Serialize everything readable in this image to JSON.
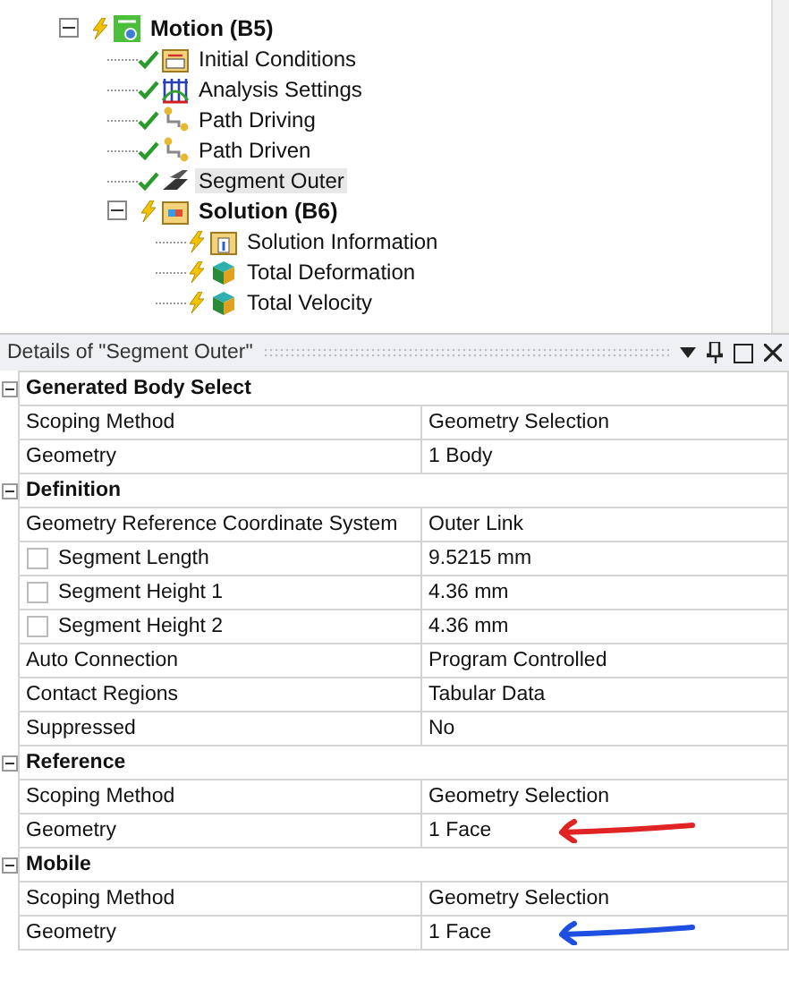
{
  "tree": [
    {
      "label": "Motion (B5)",
      "solved": false,
      "kind": "environment",
      "expanded": true,
      "selected": false,
      "children": [
        {
          "label": "Initial Conditions",
          "solved": true,
          "kind": "conditions",
          "selected": false
        },
        {
          "label": "Analysis Settings",
          "solved": true,
          "kind": "settings",
          "selected": false
        },
        {
          "label": "Path Driving",
          "solved": true,
          "kind": "path",
          "selected": false
        },
        {
          "label": "Path Driven",
          "solved": true,
          "kind": "path",
          "selected": false
        },
        {
          "label": "Segment Outer",
          "solved": true,
          "kind": "segment",
          "selected": true
        },
        {
          "label": "Solution (B6)",
          "solved": false,
          "kind": "solution",
          "expanded": true,
          "selected": false,
          "children": [
            {
              "label": "Solution Information",
              "solved": false,
              "kind": "info",
              "selected": false
            },
            {
              "label": "Total Deformation",
              "solved": false,
              "kind": "result",
              "selected": false
            },
            {
              "label": "Total Velocity",
              "solved": false,
              "kind": "result",
              "selected": false
            }
          ]
        }
      ]
    }
  ],
  "details": {
    "title": "Details of \"Segment Outer\"",
    "sections": [
      {
        "title": "Generated Body Select",
        "expanded": true,
        "rows": [
          {
            "kind": "plain",
            "label": "Scoping Method",
            "value": "Geometry Selection"
          },
          {
            "kind": "plain",
            "label": "Geometry",
            "value": "1 Body"
          }
        ]
      },
      {
        "title": "Definition",
        "expanded": true,
        "rows": [
          {
            "kind": "plain",
            "label": "Geometry Reference Coordinate System",
            "value": "Outer Link"
          },
          {
            "kind": "parameter",
            "checked": false,
            "label": "Segment Length",
            "value": "9.5215 mm"
          },
          {
            "kind": "parameter",
            "checked": false,
            "label": "Segment Height 1",
            "value": "4.36 mm"
          },
          {
            "kind": "parameter",
            "checked": false,
            "label": "Segment Height 2",
            "value": "4.36 mm"
          },
          {
            "kind": "plain",
            "label": "Auto Connection",
            "value": "Program Controlled"
          },
          {
            "kind": "plain",
            "label": "Contact Regions",
            "value": "Tabular Data"
          },
          {
            "kind": "plain",
            "label": "Suppressed",
            "value": "No"
          }
        ]
      },
      {
        "title": "Reference",
        "expanded": true,
        "rows": [
          {
            "kind": "plain",
            "label": "Scoping Method",
            "value": "Geometry Selection"
          },
          {
            "kind": "plain",
            "label": "Geometry",
            "value": "1 Face",
            "arrow": {
              "color": "#e02424"
            }
          }
        ]
      },
      {
        "title": "Mobile",
        "expanded": true,
        "rows": [
          {
            "kind": "plain",
            "label": "Scoping Method",
            "value": "Geometry Selection"
          },
          {
            "kind": "plain",
            "label": "Geometry",
            "value": "1 Face",
            "arrow": {
              "color": "#1f4fe0"
            }
          }
        ]
      }
    ]
  }
}
